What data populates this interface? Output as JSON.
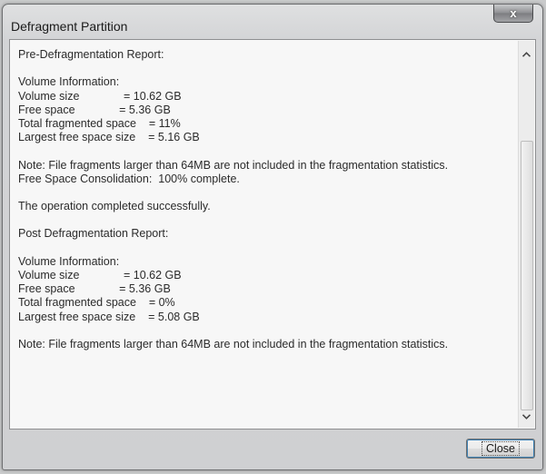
{
  "window": {
    "title": "Defragment Partition",
    "close_glyph": "x"
  },
  "report": {
    "lines": [
      "Pre-Defragmentation Report:",
      "",
      "Volume Information:",
      "Volume size              = 10.62 GB",
      "Free space              = 5.36 GB",
      "Total fragmented space    = 11%",
      "Largest free space size    = 5.16 GB",
      "",
      "Note: File fragments larger than 64MB are not included in the fragmentation statistics.",
      "Free Space Consolidation:  100% complete.",
      "",
      "The operation completed successfully.",
      "",
      "Post Defragmentation Report:",
      "",
      "Volume Information:",
      "Volume size              = 10.62 GB",
      "Free space              = 5.36 GB",
      "Total fragmented space    = 0%",
      "Largest free space size    = 5.08 GB",
      "",
      "Note: File fragments larger than 64MB are not included in the fragmentation statistics."
    ]
  },
  "scrollbar": {
    "up_icon": "chevron-up-icon",
    "down_icon": "chevron-down-icon"
  },
  "buttons": {
    "close_label": "Close"
  }
}
